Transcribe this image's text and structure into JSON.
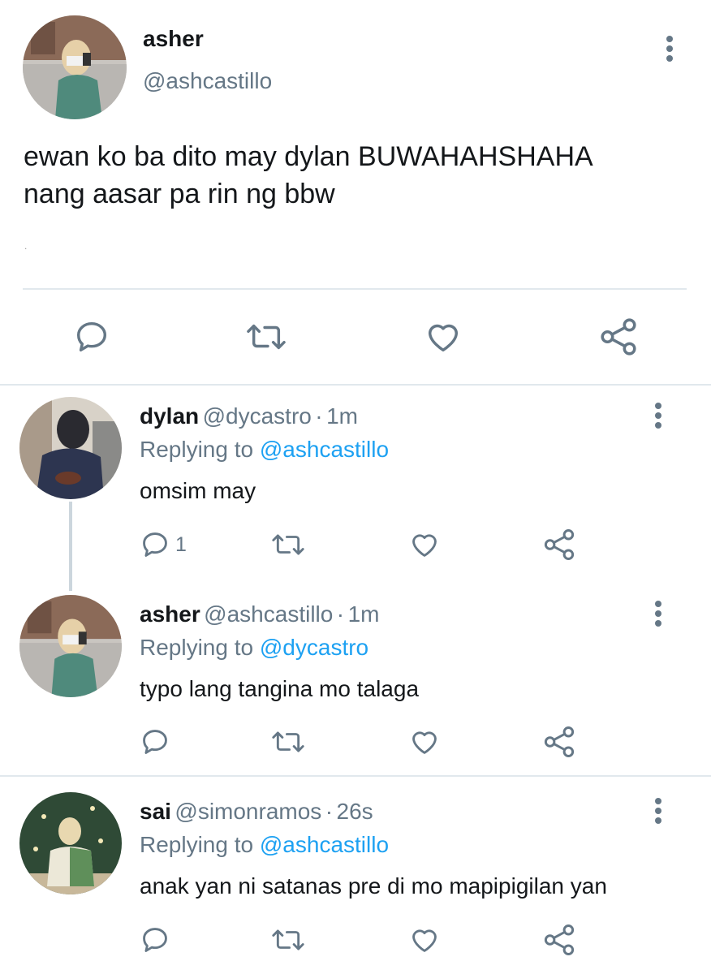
{
  "main_tweet": {
    "name": "asher",
    "handle": "@ashcastillo",
    "text_line1": "ewan ko ba dito may dylan BUWAHAHSHAHA",
    "text_line2": "nang aasar pa rin ng bbw",
    "trailing_mark": "."
  },
  "replies": [
    {
      "name": "dylan",
      "handle": "@dycastro",
      "sep": "·",
      "time": "1m",
      "replying_prefix": "Replying to",
      "replying_to": "@ashcastillo",
      "text": "omsim may",
      "reply_count": "1"
    },
    {
      "name": "asher",
      "handle": "@ashcastillo",
      "sep": "·",
      "time": "1m",
      "replying_prefix": "Replying to",
      "replying_to": "@dycastro",
      "text": "typo lang tangina mo talaga",
      "reply_count": ""
    },
    {
      "name": "sai",
      "handle": "@simonramos",
      "sep": "·",
      "time": "26s",
      "replying_prefix": "Replying to",
      "replying_to": "@ashcastillo",
      "text": "anak yan ni satanas pre di mo mapipigilan yan",
      "reply_count": ""
    }
  ],
  "icons": {
    "reply": "reply-icon",
    "retweet": "retweet-icon",
    "like": "heart-icon",
    "share": "share-icon",
    "more": "more-vertical-icon"
  },
  "colors": {
    "text": "#14171a",
    "secondary": "#657786",
    "link": "#1da1f2",
    "divider": "#e1e8ed"
  }
}
